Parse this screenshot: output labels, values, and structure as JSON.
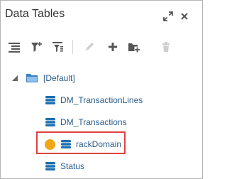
{
  "panel": {
    "title": "Data Tables",
    "icons": {
      "expand": "expand-arrows-icon",
      "close": "close-icon"
    }
  },
  "toolbar": {
    "buttons": [
      {
        "icon": "list-columns-icon",
        "enabled": true
      },
      {
        "icon": "filter-add-icon",
        "enabled": true
      },
      {
        "icon": "filter-list-icon",
        "enabled": true
      },
      {
        "icon": "edit-pencil-icon",
        "enabled": false
      },
      {
        "icon": "add-plus-icon",
        "enabled": true
      },
      {
        "icon": "add-folder-icon",
        "enabled": true
      },
      {
        "icon": "delete-trash-icon",
        "enabled": false
      }
    ]
  },
  "tree": {
    "root": {
      "label": "[Default]",
      "expanded": true,
      "icon": "folder-icon"
    },
    "children": [
      {
        "label": "DM_TransactionLines",
        "icon": "database-icon"
      },
      {
        "label": "DM_Transactions",
        "icon": "database-icon"
      },
      {
        "label": "rackDomain",
        "icon": "database-icon",
        "status": "warning",
        "highlighted": true
      },
      {
        "label": "Status",
        "icon": "database-icon"
      }
    ]
  },
  "colors": {
    "accent": "#1e6fb0",
    "label": "#2a5d8a",
    "status_dot": "#f2a617",
    "highlight_border": "#e0413f"
  }
}
